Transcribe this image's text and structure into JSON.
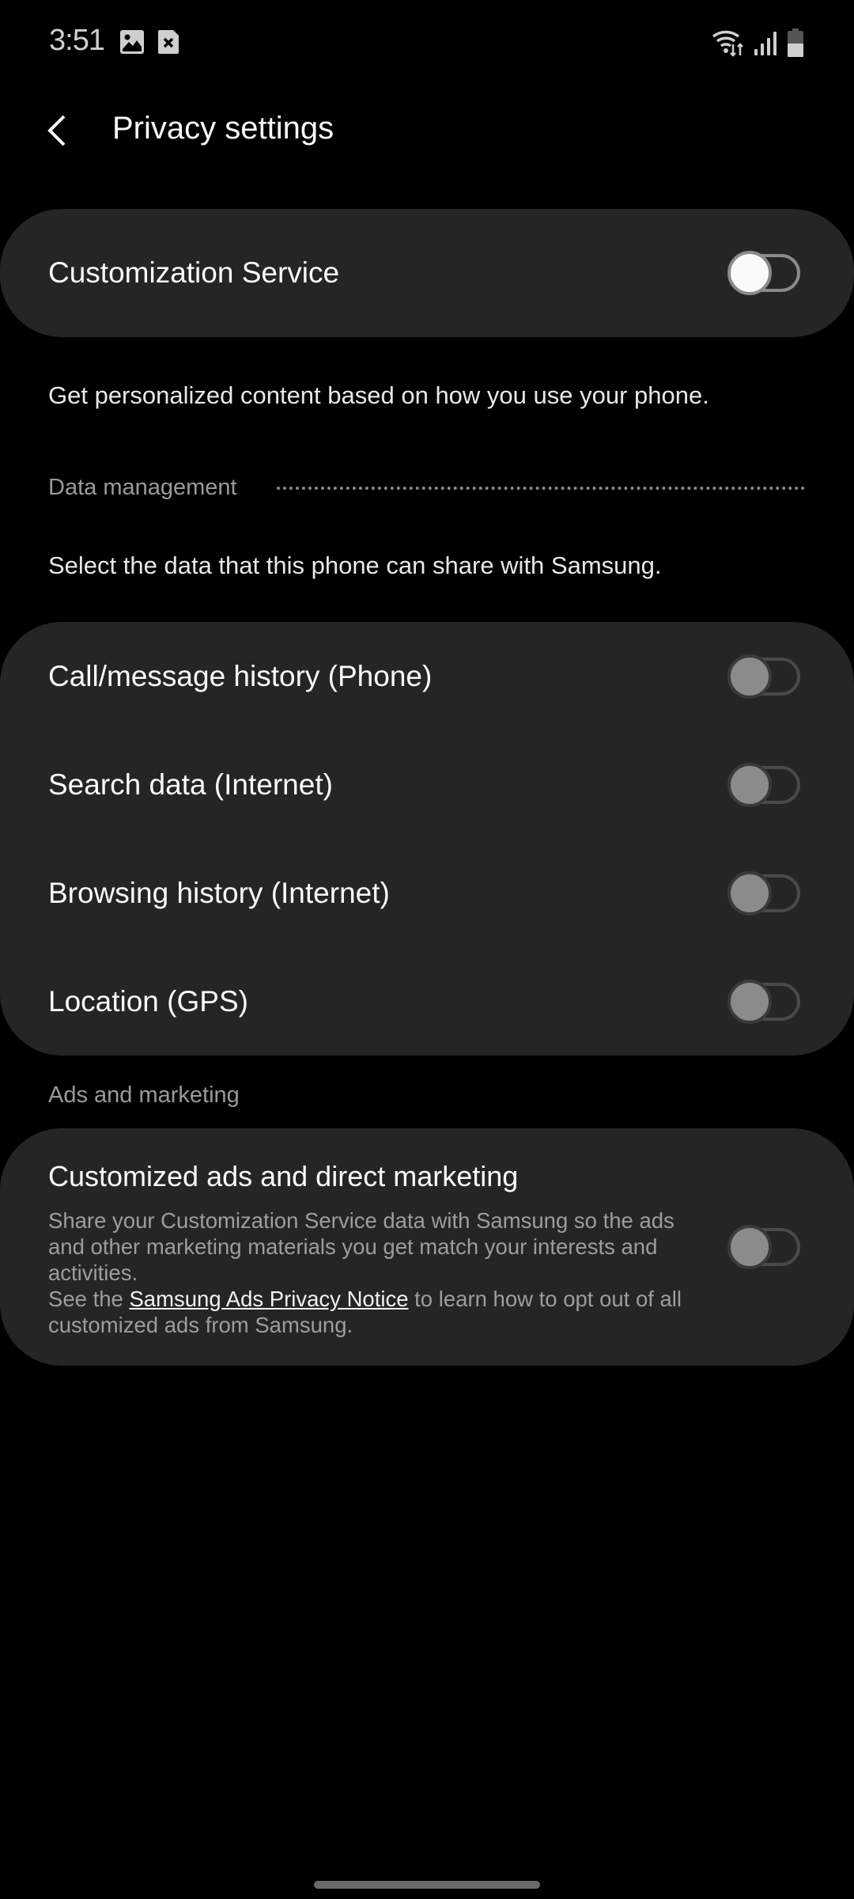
{
  "status_bar": {
    "time": "3:51",
    "notification_icons": [
      "gallery-icon",
      "sim-card-error-icon"
    ],
    "system_icons": [
      "wifi-data-icon",
      "signal-icon",
      "battery-icon"
    ]
  },
  "app_bar": {
    "back_icon": "chevron-left-icon",
    "title": "Privacy settings"
  },
  "master_toggle": {
    "label": "Customization Service",
    "checked": false,
    "enabled": true
  },
  "master_description": "Get personalized content based on how you use your phone.",
  "data_management": {
    "header": "Data management",
    "description": "Select the data that this phone can share with Samsung.",
    "items": [
      {
        "label": "Call/message history (Phone)",
        "checked": false,
        "enabled": false
      },
      {
        "label": "Search data (Internet)",
        "checked": false,
        "enabled": false
      },
      {
        "label": "Browsing history (Internet)",
        "checked": false,
        "enabled": false
      },
      {
        "label": "Location (GPS)",
        "checked": false,
        "enabled": false
      }
    ]
  },
  "ads_marketing": {
    "header": "Ads and marketing",
    "title": "Customized ads and direct marketing",
    "body_part1": "Share your Customization Service data with Samsung so the ads and other marketing materials you get match your interests and activities.",
    "body_part2_prefix": "See the ",
    "link_text": "Samsung Ads Privacy Notice",
    "body_part2_suffix": " to learn how to opt out of all customized ads from Samsung.",
    "checked": false,
    "enabled": false
  },
  "colors": {
    "background": "#000000",
    "card": "#252525",
    "text_primary": "#fafafa",
    "text_secondary": "#9d9d9d",
    "switch_off_border": "#8a8a8a",
    "switch_disabled_thumb": "#8b8b8b"
  }
}
